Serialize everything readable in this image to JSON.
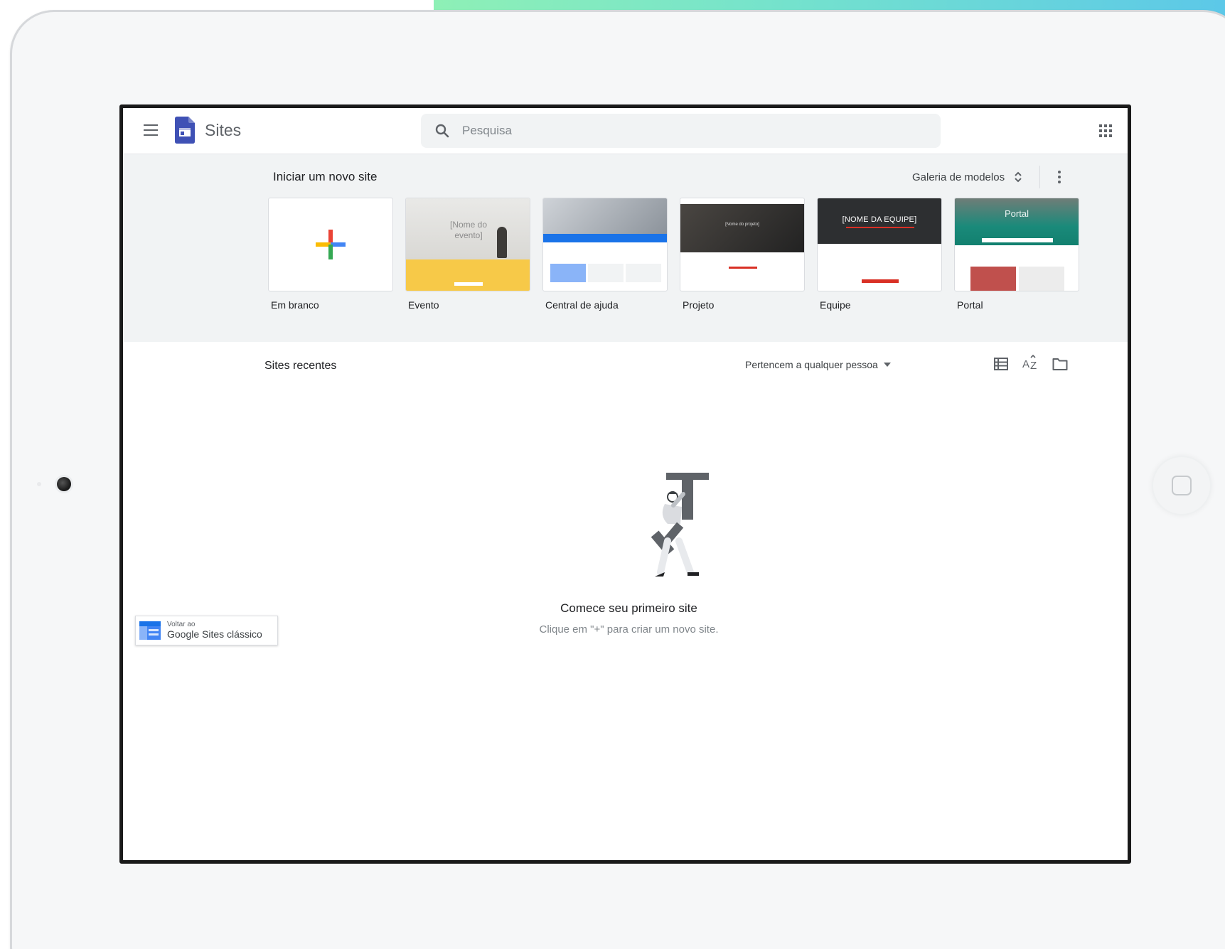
{
  "app": {
    "title": "Sites",
    "brand_color": "#3f51b5"
  },
  "search": {
    "placeholder": "Pesquisa"
  },
  "templates": {
    "heading": "Iniciar um novo site",
    "gallery_label": "Galeria de modelos",
    "items": [
      {
        "label": "Em branco"
      },
      {
        "label": "Evento",
        "thumb_title": "[Nome do evento]"
      },
      {
        "label": "Central de ajuda"
      },
      {
        "label": "Projeto",
        "thumb_title": "[Nome do projeto]"
      },
      {
        "label": "Equipe",
        "thumb_title": "[NOME DA EQUIPE]"
      },
      {
        "label": "Portal",
        "thumb_title": "Portal"
      }
    ]
  },
  "recent": {
    "heading": "Sites recentes",
    "owner_filter": "Pertencem a qualquer pessoa",
    "empty_title": "Comece seu primeiro site",
    "empty_subtitle": "Clique em \"+\" para criar um novo site."
  },
  "classic": {
    "small": "Voltar ao",
    "main": "Google Sites clássico"
  },
  "icons": {
    "menu": "hamburger-menu-icon",
    "search": "search-icon",
    "apps": "apps-grid-icon",
    "unfold": "unfold-more-icon",
    "more": "more-vert-icon",
    "list": "list-view-icon",
    "sort": "sort-az-icon",
    "folder": "folder-icon"
  },
  "colors": {
    "plus_red": "#ea4335",
    "plus_blue": "#4285f4",
    "plus_yellow": "#fbbc04",
    "plus_green": "#34a853",
    "accent_gradient_start": "#8ef0b6",
    "accent_gradient_end": "#5cc8e8"
  }
}
